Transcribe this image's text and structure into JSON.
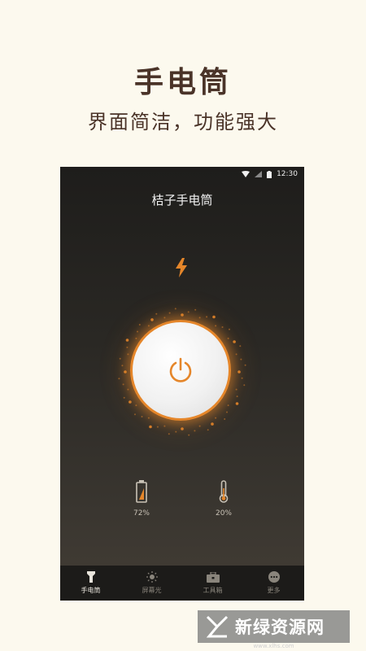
{
  "promo": {
    "title": "手电筒",
    "subtitle": "界面简洁，功能强大"
  },
  "status_bar": {
    "time": "12:30",
    "icons": [
      "wifi-icon",
      "signal-icon",
      "battery-icon"
    ]
  },
  "app": {
    "title": "桔子手电筒",
    "flash_icon": "bolt-icon",
    "power_button_icon": "power-icon",
    "accent_color": "#e5862a",
    "battery": {
      "value": "72%",
      "icon": "battery-level-icon"
    },
    "temperature": {
      "value": "20%",
      "icon": "thermometer-icon"
    }
  },
  "bottom_nav": {
    "items": [
      {
        "label": "手电筒",
        "icon": "flashlight-icon",
        "active": true
      },
      {
        "label": "屏幕光",
        "icon": "sun-icon",
        "active": false
      },
      {
        "label": "工具箱",
        "icon": "toolbox-icon",
        "active": false
      },
      {
        "label": "更多",
        "icon": "more-icon",
        "active": false
      }
    ]
  },
  "watermark": {
    "text": "新绿资源网",
    "url": "www.xlhs.com"
  }
}
